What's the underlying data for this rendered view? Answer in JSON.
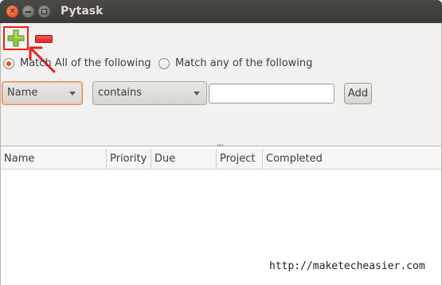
{
  "window": {
    "title": "Pytask",
    "controls": [
      "close-icon",
      "minimize-icon",
      "maximize-icon"
    ]
  },
  "toolbar": {
    "add_icon": "plus-icon",
    "remove_icon": "minus-icon",
    "add_color": "#8dc63f",
    "remove_color": "#e2322c",
    "annotation_color": "#e8221b"
  },
  "filter": {
    "match_all_label": "Match All of the following",
    "match_any_label": "Match any of the following",
    "selected": "match_all",
    "field_value": "Name",
    "operator_value": "contains",
    "text_value": "",
    "add_label": "Add"
  },
  "columns": [
    "Name",
    "Priority",
    "Due",
    "Project",
    "Completed"
  ],
  "rows": [],
  "watermark": "http://maketecheasier.com",
  "accent": "#e95420"
}
